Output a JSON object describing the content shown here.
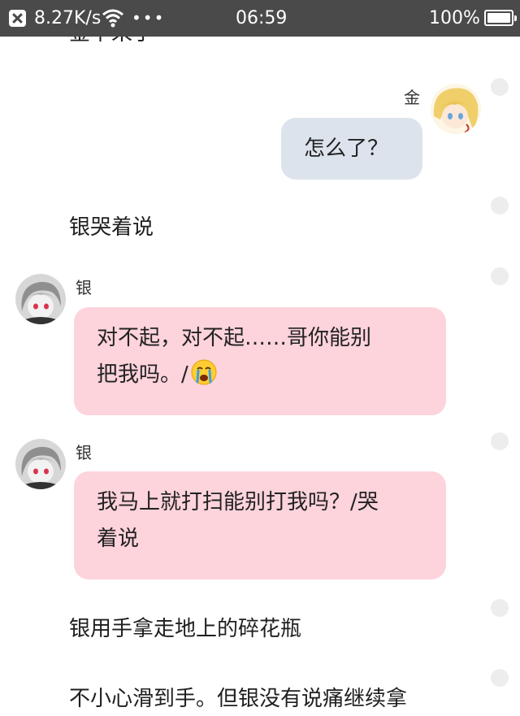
{
  "status_bar": {
    "network_speed": "8.27K/s",
    "time": "06:59",
    "battery": "100%",
    "icons": [
      "close-notification-icon",
      "wifi-icon",
      "more-dots-icon",
      "battery-icon"
    ]
  },
  "chat": {
    "top_partial_text": "金下来了",
    "messages": [
      {
        "sender": "金",
        "side": "right",
        "text": "怎么了？"
      },
      {
        "sender": "银",
        "side": "left",
        "line1": "对不起，对不起……哥你能别",
        "line2": "把我吗。/",
        "emoji": "crying-face-icon"
      },
      {
        "sender": "银",
        "side": "left",
        "line1": "我马上就打扫能别打我吗？/哭",
        "line2": "着说"
      }
    ],
    "narration": {
      "n1": "银哭着说",
      "n2": "银用手拿走地上的碎花瓶",
      "n3": "不小心滑到手。但银没有说痛继续拿"
    }
  },
  "colors": {
    "status_bar_bg": "#4a4a4a",
    "bubble_right_bg": "#dde3ec",
    "bubble_left_bg": "#fdd3dc"
  }
}
